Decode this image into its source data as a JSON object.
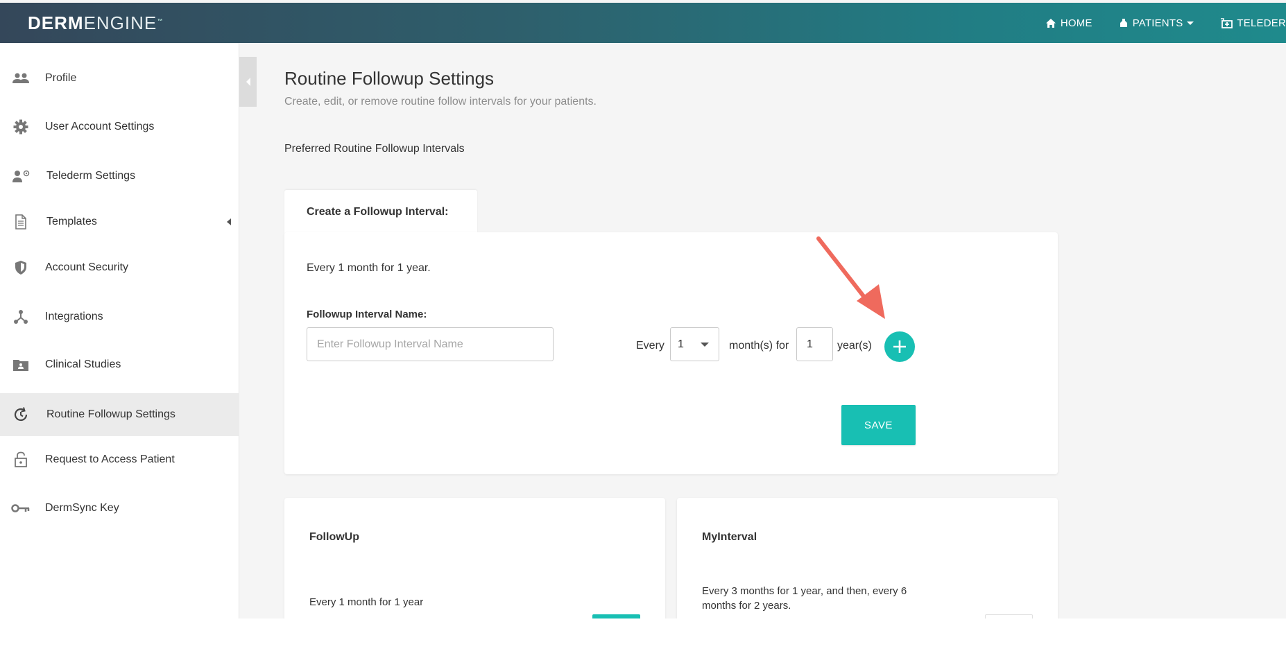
{
  "brand": {
    "bold": "DERM",
    "light": "ENGINE",
    "tm": "™"
  },
  "topnav": {
    "home": "HOME",
    "patients": "PATIENTS",
    "telederm": "TELEDER"
  },
  "sidebar": {
    "items": [
      {
        "label": "Profile",
        "icon": "people-icon"
      },
      {
        "label": "User Account Settings",
        "icon": "gear-icon"
      },
      {
        "label": "Telederm Settings",
        "icon": "user-settings-icon"
      },
      {
        "label": "Templates",
        "icon": "document-icon"
      },
      {
        "label": "Account Security",
        "icon": "shield-icon"
      },
      {
        "label": "Integrations",
        "icon": "integrations-icon"
      },
      {
        "label": "Clinical Studies",
        "icon": "folder-icon"
      },
      {
        "label": "Routine Followup Settings",
        "icon": "history-icon"
      },
      {
        "label": "Request to Access Patient",
        "icon": "lock-icon"
      },
      {
        "label": "DermSync Key",
        "icon": "key-icon"
      }
    ]
  },
  "page": {
    "title": "Routine Followup Settings",
    "subtitle": "Create, edit, or remove routine follow intervals for your patients.",
    "section_label": "Preferred Routine Followup Intervals"
  },
  "create_card": {
    "tab_label": "Create a Followup Interval:",
    "summary": "Every 1 month for 1 year.",
    "name_label": "Followup Interval Name:",
    "name_placeholder": "Enter Followup Interval Name",
    "name_value": "",
    "every_label": "Every",
    "months_value": "1",
    "months_label": "month(s) for",
    "years_value": "1",
    "years_label": "year(s)",
    "save_label": "SAVE"
  },
  "intervals": [
    {
      "name": "FollowUp",
      "description": "Every 1 month for 1 year"
    },
    {
      "name": "MyInterval",
      "description": "Every 3 months for 1 year, and then, every 6 months for 2 years."
    }
  ],
  "colors": {
    "accent": "#18bfb3",
    "annotation_arrow": "#ef6a5d"
  }
}
